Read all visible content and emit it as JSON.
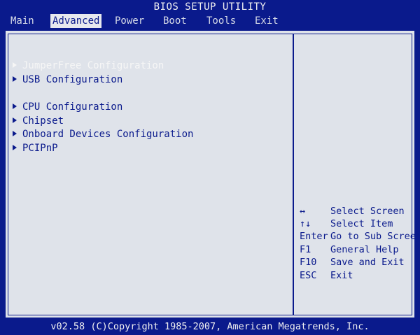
{
  "title": "BIOS SETUP UTILITY",
  "menu": {
    "items": [
      {
        "label": "Main"
      },
      {
        "label": "Advanced"
      },
      {
        "label": "Power"
      },
      {
        "label": "Boot"
      },
      {
        "label": "Tools"
      },
      {
        "label": "Exit"
      }
    ],
    "active": "Advanced"
  },
  "options": [
    {
      "label": "JumperFree Configuration"
    },
    {
      "label": "USB Configuration"
    },
    {
      "label": "CPU Configuration"
    },
    {
      "label": "Chipset"
    },
    {
      "label": "Onboard Devices Configuration"
    },
    {
      "label": "PCIPnP"
    }
  ],
  "help": [
    {
      "key": "↔",
      "text": "Select Screen"
    },
    {
      "key": "↑↓",
      "text": "Select Item"
    },
    {
      "key": "Enter",
      "text": "Go to Sub Screen"
    },
    {
      "key": "F1",
      "text": "General Help"
    },
    {
      "key": "F10",
      "text": "Save and Exit"
    },
    {
      "key": "ESC",
      "text": "Exit"
    }
  ],
  "footer": "v02.58 (C)Copyright 1985-2007, American Megatrends, Inc.",
  "colors": {
    "background": "#0a1a8c",
    "panel": "#dfe3ea",
    "highlight_text": "#f6f6f6"
  },
  "icons": {
    "option_marker": "triangle-right-icon"
  }
}
